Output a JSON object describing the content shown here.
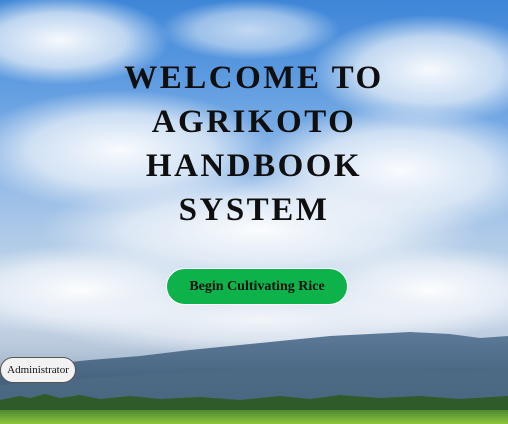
{
  "hero": {
    "title_lines": [
      "WELCOME TO",
      "AGRIKOTO",
      "HANDBOOK",
      "SYSTEM"
    ],
    "cta_label": "Begin Cultivating Rice",
    "accent_color": "#0db34a"
  },
  "footer": {
    "admin_label": "Administrator"
  },
  "background": {
    "description_icon": "sky-mountain-field-image"
  }
}
